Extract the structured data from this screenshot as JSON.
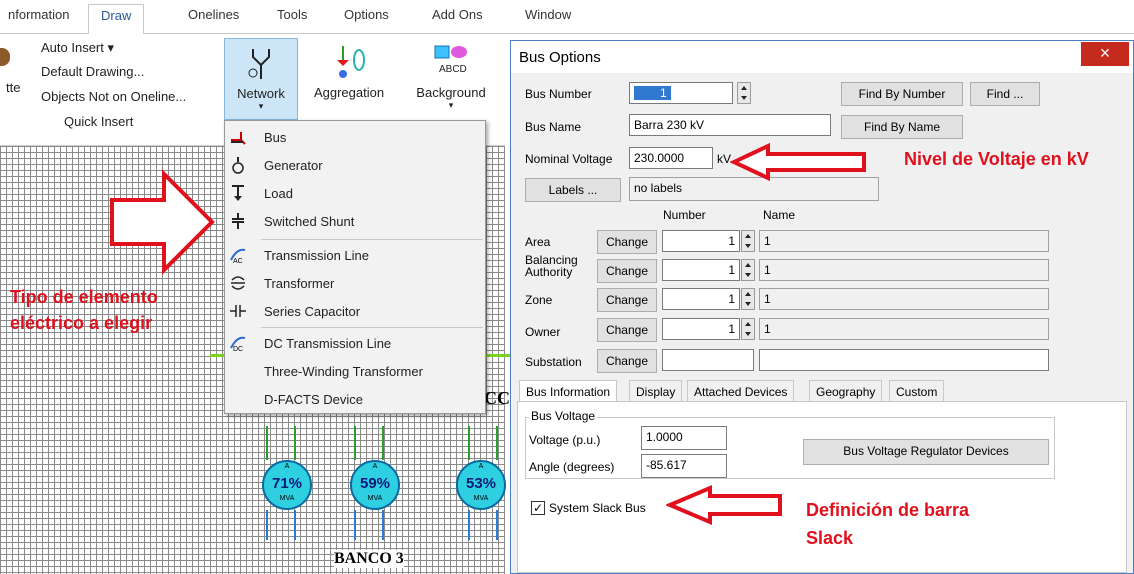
{
  "ribbon": {
    "tabs": [
      "nformation",
      "Draw",
      "Onelines",
      "Tools",
      "Options",
      "Add Ons",
      "Window"
    ],
    "active_tab": "Draw",
    "left_menu": [
      "Auto Insert",
      "Default Drawing...",
      "Objects Not on Oneline...",
      "Quick Insert"
    ],
    "left_stub": "tte",
    "buttons": {
      "network": "Network",
      "aggregation": "Aggregation",
      "background": "Background"
    }
  },
  "network_menu": {
    "items": [
      {
        "label": "Bus",
        "icon": "bus-icon"
      },
      {
        "label": "Generator",
        "icon": "generator-icon"
      },
      {
        "label": "Load",
        "icon": "load-icon"
      },
      {
        "label": "Switched Shunt",
        "icon": "shunt-icon"
      },
      {
        "label": "Transmission Line",
        "icon": "transmission-line-icon"
      },
      {
        "label": "Transformer",
        "icon": "transformer-icon"
      },
      {
        "label": "Series Capacitor",
        "icon": "series-capacitor-icon"
      },
      {
        "label": "DC Transmission Line",
        "icon": "dc-line-icon"
      },
      {
        "label": "Three-Winding Transformer",
        "icon": ""
      },
      {
        "label": "D-FACTS Device",
        "icon": ""
      }
    ]
  },
  "canvas": {
    "gauges": [
      {
        "a_label": "A",
        "pct": "71%",
        "mva_label": "MVA"
      },
      {
        "a_label": "A",
        "pct": "59%",
        "mva_label": "MVA"
      },
      {
        "a_label": "A",
        "pct": "53%",
        "mva_label": "MVA"
      }
    ],
    "bank_label": "BANCO 3",
    "partial_label": "CC"
  },
  "annotations": {
    "element_type": "Tipo de elemento\neléctrico a elegir",
    "voltage_level": "Nivel de Voltaje en kV",
    "slack": "Definición de barra\nSlack"
  },
  "dialog": {
    "title": "Bus Options",
    "close": "×",
    "bus_number_label": "Bus Number",
    "bus_number_value": "1",
    "find_by_number": "Find By Number",
    "find": "Find ...",
    "bus_name_label": "Bus Name",
    "bus_name_value": "Barra 230 kV",
    "find_by_name": "Find By Name",
    "nominal_voltage_label": "Nominal Voltage",
    "nominal_voltage_value": "230.0000",
    "kv_unit": "kV",
    "labels_button": "Labels ...",
    "labels_value": "no labels",
    "col_number": "Number",
    "col_name": "Name",
    "rows": [
      {
        "label": "Area",
        "button": "Change",
        "number": "1",
        "name": "1"
      },
      {
        "label": "Balancing\nAuthority",
        "button": "Change",
        "number": "1",
        "name": "1"
      },
      {
        "label": "Zone",
        "button": "Change",
        "number": "1",
        "name": "1"
      },
      {
        "label": "Owner",
        "button": "Change",
        "number": "1",
        "name": "1"
      },
      {
        "label": "Substation",
        "button": "Change",
        "number": "",
        "name": ""
      }
    ],
    "tabs": [
      "Bus Information",
      "Display",
      "Attached Devices",
      "Geography",
      "Custom"
    ],
    "active_tab": "Bus Information",
    "bus_voltage_group": "Bus Voltage",
    "voltage_pu_label": "Voltage (p.u.)",
    "voltage_pu_value": "1.0000",
    "angle_label": "Angle (degrees)",
    "angle_value": "-85.617",
    "regulator_button": "Bus Voltage Regulator Devices",
    "slack_checkbox_label": "System Slack Bus",
    "slack_checked": true
  },
  "colors": {
    "annotation": "#e0101d",
    "accent": "#2b5797",
    "gauge": "#2ecfe0"
  }
}
